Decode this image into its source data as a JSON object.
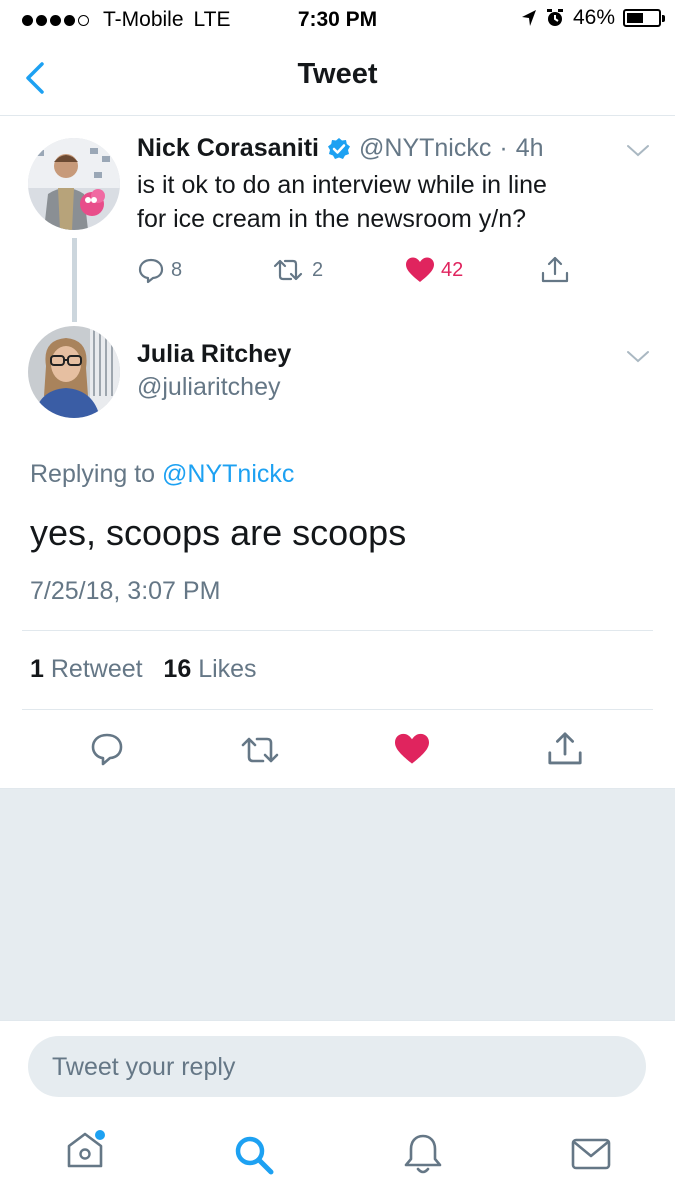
{
  "status_bar": {
    "carrier": "T-Mobile",
    "network": "LTE",
    "time": "7:30 PM",
    "battery": "46%",
    "battery_level": 0.46
  },
  "nav": {
    "title": "Tweet",
    "back_icon": "chevron-left-icon"
  },
  "parent_tweet": {
    "name": "Nick Corasaniti",
    "verified": true,
    "handle": "@NYTnickc",
    "separator": "·",
    "age": "4h",
    "text_line1": "is it ok to do an interview while in line",
    "text_line2": "for ice cream in the newsroom y/n?",
    "replies": "8",
    "retweets": "2",
    "likes": "42"
  },
  "main_tweet": {
    "name": "Julia Ritchey",
    "handle": "@juliaritchey",
    "replying_prefix": "Replying to",
    "replying_to": "@NYTnickc",
    "text": "yes, scoops are scoops",
    "timestamp": "7/25/18, 3:07 PM",
    "retweet_count": "1",
    "retweet_label": "Retweet",
    "like_count": "16",
    "like_label": "Likes"
  },
  "reply_box": {
    "placeholder": "Tweet your reply"
  },
  "tab_bar": {
    "items": [
      "home-icon",
      "search-icon",
      "notifications-icon",
      "messages-icon"
    ]
  },
  "colors": {
    "accent": "#1da1f2",
    "like": "#e0245e",
    "muted": "#657786",
    "divider": "#e1e8ed"
  }
}
